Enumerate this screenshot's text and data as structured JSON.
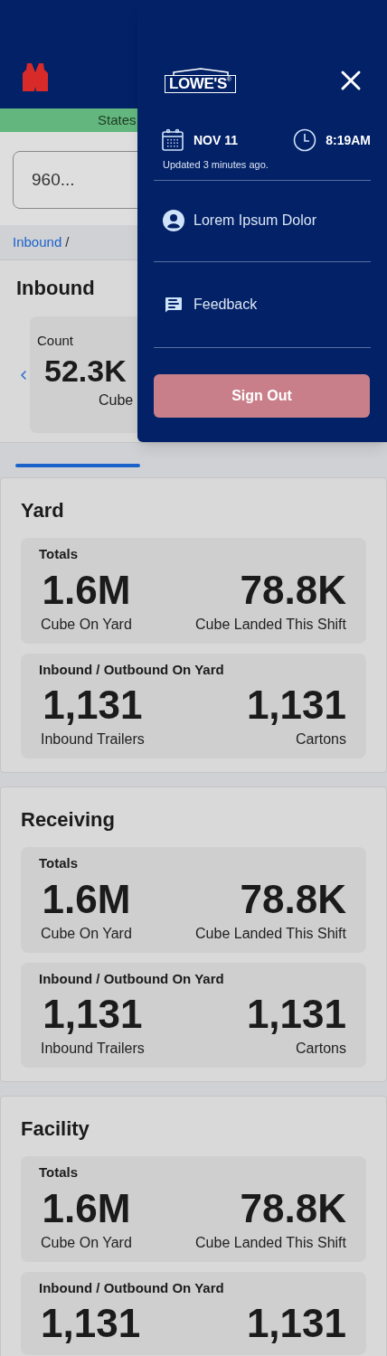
{
  "status_banner": {
    "text": "States"
  },
  "search": {
    "value": "960..."
  },
  "breadcrumb": {
    "link": "Inbound",
    "separator": "/"
  },
  "inbound_card": {
    "title": "Inbound",
    "metric": {
      "label": "Count",
      "value": "52.3K",
      "unit": "Cube"
    }
  },
  "sections": [
    {
      "title": "Yard",
      "groups": [
        {
          "title": "Totals",
          "metrics": [
            {
              "value": "1.6M",
              "label": "Cube On Yard"
            },
            {
              "value": "78.8K",
              "label": "Cube Landed This Shift"
            }
          ]
        },
        {
          "title": "Inbound / Outbound On Yard",
          "metrics": [
            {
              "value": "1,131",
              "label": "Inbound Trailers"
            },
            {
              "value": "1,131",
              "label": "Cartons"
            }
          ]
        }
      ]
    },
    {
      "title": "Receiving",
      "groups": [
        {
          "title": "Totals",
          "metrics": [
            {
              "value": "1.6M",
              "label": "Cube On Yard"
            },
            {
              "value": "78.8K",
              "label": "Cube Landed This Shift"
            }
          ]
        },
        {
          "title": "Inbound / Outbound On Yard",
          "metrics": [
            {
              "value": "1,131",
              "label": "Inbound Trailers"
            },
            {
              "value": "1,131",
              "label": "Cartons"
            }
          ]
        }
      ]
    },
    {
      "title": "Facility",
      "groups": [
        {
          "title": "Totals",
          "metrics": [
            {
              "value": "1.6M",
              "label": "Cube On Yard"
            },
            {
              "value": "78.8K",
              "label": "Cube Landed This Shift"
            }
          ]
        },
        {
          "title": "Inbound / Outbound On Yard",
          "metrics": [
            {
              "value": "1,131"
            },
            {
              "value": "1,131"
            }
          ]
        }
      ]
    }
  ],
  "drawer": {
    "logo": "LOWE'S",
    "logo_mark": "®",
    "date": "NOV 11",
    "time": "8:19AM",
    "updated": "Updated 3 minutes ago.",
    "items": [
      {
        "kind": "user",
        "label": "Lorem Ipsum Dolor"
      },
      {
        "kind": "feedback",
        "label": "Feedback"
      }
    ],
    "sign_out": "Sign Out"
  }
}
